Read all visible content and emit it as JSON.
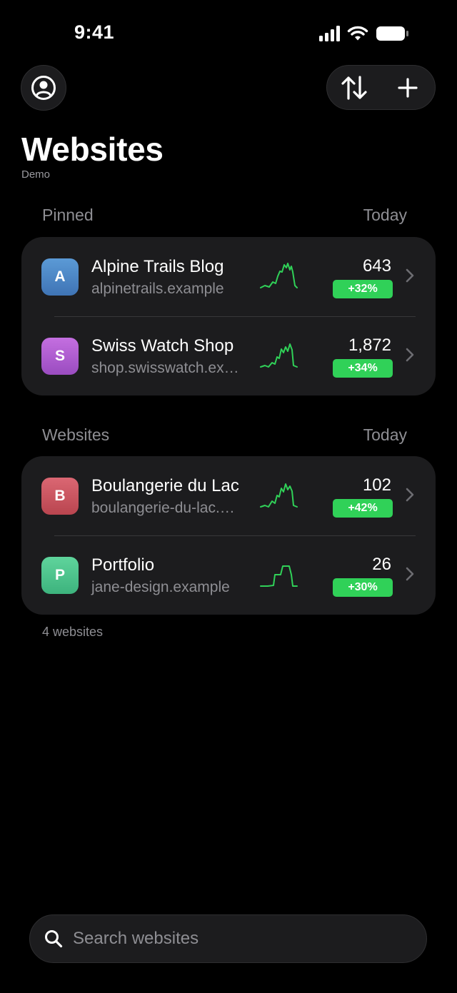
{
  "status_bar": {
    "time": "9:41"
  },
  "header": {
    "title": "Websites",
    "subtitle": "Demo"
  },
  "sections": [
    {
      "label": "Pinned",
      "period": "Today",
      "rows": [
        {
          "initial": "A",
          "name": "Alpine Trails Blog",
          "domain": "alpinetrails.example",
          "visits": "643",
          "change": "+32%",
          "avatar_color": "#4f87c9"
        },
        {
          "initial": "S",
          "name": "Swiss Watch Shop",
          "domain": "shop.swisswatch.ex…",
          "visits": "1,872",
          "change": "+34%",
          "avatar_color": "#b05ed0"
        }
      ]
    },
    {
      "label": "Websites",
      "period": "Today",
      "rows": [
        {
          "initial": "B",
          "name": "Boulangerie du Lac",
          "domain": "boulangerie-du-lac.…",
          "visits": "102",
          "change": "+42%",
          "avatar_color": "#cf5662"
        },
        {
          "initial": "P",
          "name": "Portfolio",
          "domain": "jane-design.example",
          "visits": "26",
          "change": "+30%",
          "avatar_color": "#4ec58e"
        }
      ]
    }
  ],
  "footer": {
    "count_text": "4 websites"
  },
  "search": {
    "placeholder": "Search websites"
  },
  "colors": {
    "accent_green": "#30d158",
    "card": "#1c1c1e"
  }
}
